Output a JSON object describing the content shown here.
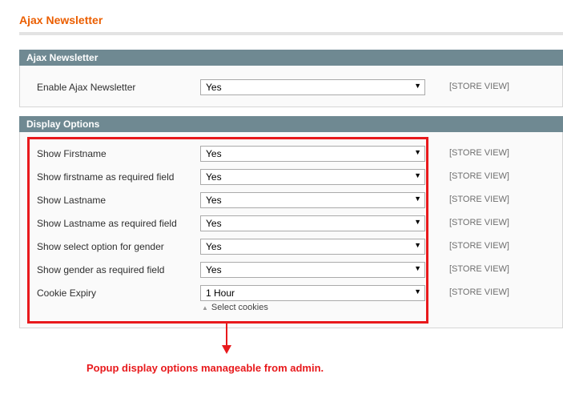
{
  "page": {
    "title": "Ajax Newsletter"
  },
  "sections": [
    {
      "header": "Ajax Newsletter",
      "rows": [
        {
          "label": "Enable Ajax Newsletter",
          "value": "Yes",
          "scope": "[STORE VIEW]"
        }
      ]
    },
    {
      "header": "Display Options",
      "rows": [
        {
          "label": "Show Firstname",
          "value": "Yes",
          "scope": "[STORE VIEW]"
        },
        {
          "label": "Show firstname as required field",
          "value": "Yes",
          "scope": "[STORE VIEW]"
        },
        {
          "label": "Show Lastname",
          "value": "Yes",
          "scope": "[STORE VIEW]"
        },
        {
          "label": "Show Lastname as required field",
          "value": "Yes",
          "scope": "[STORE VIEW]"
        },
        {
          "label": "Show select option for gender",
          "value": "Yes",
          "scope": "[STORE VIEW]"
        },
        {
          "label": "Show gender as required field",
          "value": "Yes",
          "scope": "[STORE VIEW]"
        },
        {
          "label": "Cookie Expiry",
          "value": "1 Hour",
          "scope": "[STORE VIEW]",
          "hint": "Select cookies"
        }
      ]
    }
  ],
  "annotation": {
    "caption": "Popup display options manageable from admin.",
    "color": "#e8191c"
  },
  "colors": {
    "title": "#eb5e00",
    "section_header_bg": "#6f8992"
  },
  "icons": {
    "dropdown": "triangle-down",
    "hint": "triangle-up"
  }
}
